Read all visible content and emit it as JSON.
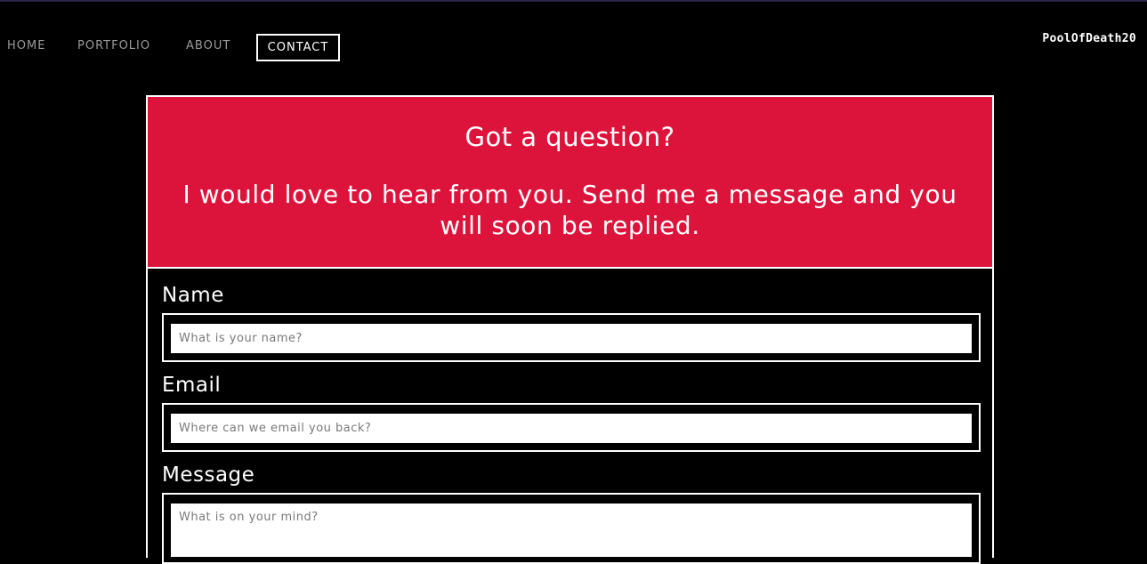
{
  "nav": {
    "items": [
      {
        "label": "HOME"
      },
      {
        "label": "PORTFOLIO"
      },
      {
        "label": "ABOUT"
      },
      {
        "label": "CONTACT"
      }
    ],
    "active": "CONTACT"
  },
  "site": {
    "title": "PoolOfDeath20"
  },
  "banner": {
    "heading": "Got a question?",
    "text": "I would love to hear from you. Send me a message and you will soon be replied.",
    "color": "#dc143c"
  },
  "form": {
    "name": {
      "label": "Name",
      "placeholder": "What is your name?",
      "value": ""
    },
    "email": {
      "label": "Email",
      "placeholder": "Where can we email you back?",
      "value": ""
    },
    "message": {
      "label": "Message",
      "placeholder": "What is on your mind?",
      "value": ""
    }
  }
}
